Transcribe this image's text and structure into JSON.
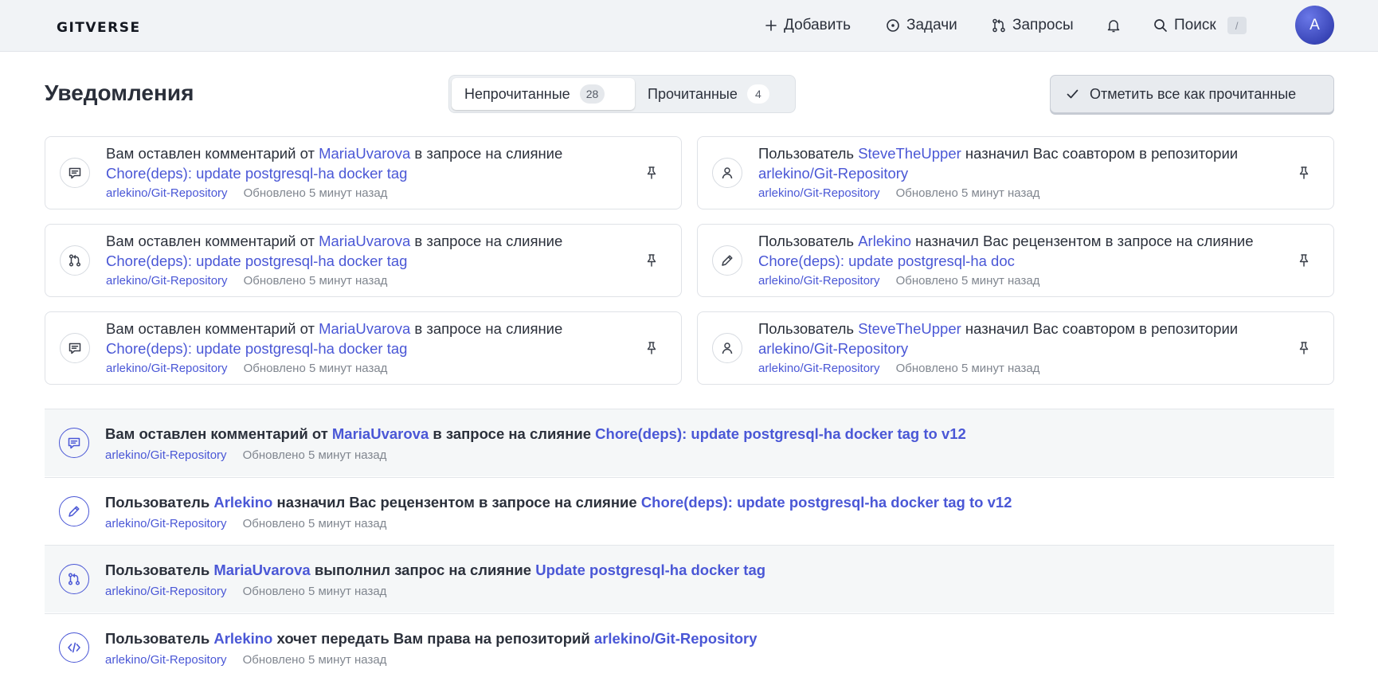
{
  "app": {
    "logo": "GITVERSE",
    "nav": {
      "add": "Добавить",
      "tasks": "Задачи",
      "requests": "Запросы",
      "search": "Поиск",
      "search_shortcut": "/"
    },
    "avatar_letter": "A"
  },
  "header": {
    "title": "Уведомления",
    "tabs": [
      {
        "label": "Непрочитанные",
        "count": "28"
      },
      {
        "label": "Прочитанные",
        "count": "4"
      }
    ],
    "mark_all": "Отметить все как прочитанные"
  },
  "cards": [
    {
      "icon": "comment-icon",
      "p1": "Вам оставлен комментарий от ",
      "user": "MariaUvarova",
      "p2": " в запросе на слияние ",
      "target": "Chore(deps): update postgresql-ha docker tag",
      "repo": "arlekino/Git-Repository",
      "time": "Обновлено 5 минут назад"
    },
    {
      "icon": "user-icon",
      "p1": "Пользователь ",
      "user": "SteveTheUpper",
      "p2": " назначил Вас соавтором в репозитории ",
      "target": "arlekino/Git-Repository",
      "repo": "arlekino/Git-Repository",
      "time": "Обновлено 5 минут назад"
    },
    {
      "icon": "pull-request-icon",
      "p1": "Вам оставлен комментарий от ",
      "user": "MariaUvarova",
      "p2": " в запросе на слияние ",
      "target": "Chore(deps): update postgresql-ha docker tag",
      "repo": "arlekino/Git-Repository",
      "time": "Обновлено 5 минут назад"
    },
    {
      "icon": "pencil-icon",
      "p1": "Пользователь ",
      "user": "Arlekino",
      "p2": " назначил Вас рецензентом в запросе на слияние ",
      "target": "Chore(deps): update postgresql-ha doc",
      "repo": "arlekino/Git-Repository",
      "time": "Обновлено 5 минут назад"
    },
    {
      "icon": "comment-icon",
      "p1": "Вам оставлен комментарий от ",
      "user": "MariaUvarova",
      "p2": " в запросе на слияние ",
      "target": "Chore(deps): update postgresql-ha docker tag",
      "repo": "arlekino/Git-Repository",
      "time": "Обновлено 5 минут назад"
    },
    {
      "icon": "user-icon",
      "p1": "Пользователь ",
      "user": "SteveTheUpper",
      "p2": " назначил Вас соавтором в репозитории ",
      "target": "arlekino/Git-Repository",
      "repo": "arlekino/Git-Repository",
      "time": "Обновлено 5 минут назад"
    }
  ],
  "rows": [
    {
      "icon": "comment-icon",
      "p1": "Вам оставлен комментарий от ",
      "user": "MariaUvarova",
      "p2": " в запросе на слияние ",
      "target": "Chore(deps): update postgresql-ha docker tag to v12",
      "repo": "arlekino/Git-Repository",
      "time": "Обновлено 5 минут назад"
    },
    {
      "icon": "pencil-icon",
      "p1": "Пользователь ",
      "user": "Arlekino",
      "p2": " назначил Вас рецензентом в запросе на слияние ",
      "target": "Chore(deps): update postgresql-ha docker tag to v12",
      "repo": "arlekino/Git-Repository",
      "time": "Обновлено 5 минут назад"
    },
    {
      "icon": "pull-request-icon",
      "p1": "Пользователь ",
      "user": "MariaUvarova",
      "p2": " выполнил запрос на слияние ",
      "target": "Update postgresql-ha docker tag",
      "repo": "arlekino/Git-Repository",
      "time": "Обновлено 5 минут назад"
    },
    {
      "icon": "code-icon",
      "p1": "Пользователь ",
      "user": "Arlekino",
      "p2": " хочет передать Вам права на репозиторий ",
      "target": "arlekino/Git-Repository",
      "repo": "arlekino/Git-Repository",
      "time": "Обновлено 5 минут назад"
    }
  ]
}
